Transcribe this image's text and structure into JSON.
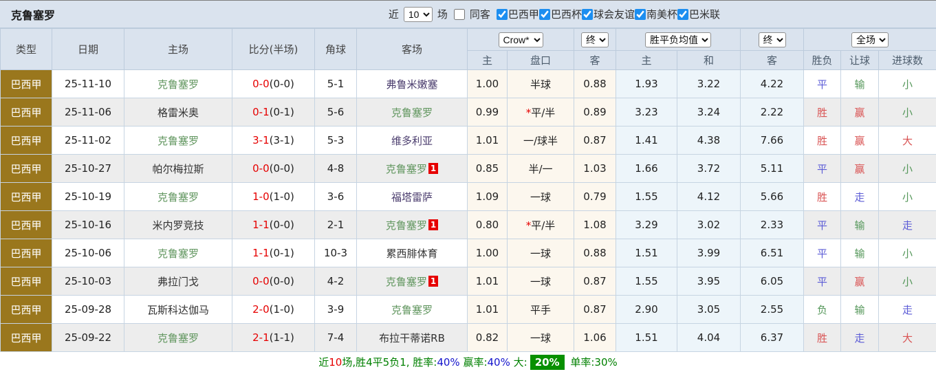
{
  "topbar": {
    "team_title": "克鲁塞罗",
    "recent_label": "近",
    "recent_select": "10",
    "matches_label": "场",
    "same_away": {
      "label": "同客",
      "checked": false
    },
    "competitions": [
      {
        "label": "巴西甲",
        "checked": true
      },
      {
        "label": "巴西杯",
        "checked": true
      },
      {
        "label": "球会友谊",
        "checked": true
      },
      {
        "label": "南美杯",
        "checked": true
      },
      {
        "label": "巴米联",
        "checked": true
      }
    ]
  },
  "table": {
    "headers": {
      "type": "类型",
      "date": "日期",
      "home": "主场",
      "score": "比分(半场)",
      "corners": "角球",
      "away": "客场",
      "asian_select": "Crow*",
      "asian_final_select": "终",
      "europe_select": "胜平负均值",
      "europe_final_select": "终",
      "scope_select": "全场",
      "asian_sub": [
        "主",
        "盘口",
        "客"
      ],
      "europe_sub": [
        "主",
        "和",
        "客"
      ],
      "result_sub": [
        "胜负",
        "让球",
        "进球数"
      ]
    },
    "rows": [
      {
        "league": "巴西甲",
        "date": "25-11-10",
        "home": {
          "name": "克鲁塞罗",
          "style": "self",
          "badge": null
        },
        "score_full": "0-0",
        "score_half": "(0-0)",
        "corners": "5-1",
        "away": {
          "name": "弗鲁米嫩塞",
          "style": "visited",
          "badge": null
        },
        "asian": {
          "home": "1.00",
          "line": "半球",
          "star": false,
          "away": "0.88"
        },
        "europe": {
          "home": "1.93",
          "draw": "3.22",
          "away": "4.22"
        },
        "result": [
          {
            "text": "平",
            "style": "blue"
          },
          {
            "text": "输",
            "style": "green"
          },
          {
            "text": "小",
            "style": "green"
          }
        ]
      },
      {
        "league": "巴西甲",
        "date": "25-11-06",
        "home": {
          "name": "格雷米奥",
          "style": "normal",
          "badge": null
        },
        "score_full": "0-1",
        "score_half": "(0-1)",
        "corners": "5-6",
        "away": {
          "name": "克鲁塞罗",
          "style": "self",
          "badge": null
        },
        "asian": {
          "home": "0.99",
          "line": "平/半",
          "star": true,
          "away": "0.89"
        },
        "europe": {
          "home": "3.23",
          "draw": "3.24",
          "away": "2.22"
        },
        "result": [
          {
            "text": "胜",
            "style": "red"
          },
          {
            "text": "赢",
            "style": "red"
          },
          {
            "text": "小",
            "style": "green"
          }
        ]
      },
      {
        "league": "巴西甲",
        "date": "25-11-02",
        "home": {
          "name": "克鲁塞罗",
          "style": "self",
          "badge": null
        },
        "score_full": "3-1",
        "score_half": "(3-1)",
        "corners": "5-3",
        "away": {
          "name": "维多利亚",
          "style": "visited",
          "badge": null
        },
        "asian": {
          "home": "1.01",
          "line": "一/球半",
          "star": false,
          "away": "0.87"
        },
        "europe": {
          "home": "1.41",
          "draw": "4.38",
          "away": "7.66"
        },
        "result": [
          {
            "text": "胜",
            "style": "red"
          },
          {
            "text": "赢",
            "style": "red"
          },
          {
            "text": "大",
            "style": "red"
          }
        ]
      },
      {
        "league": "巴西甲",
        "date": "25-10-27",
        "home": {
          "name": "帕尔梅拉斯",
          "style": "normal",
          "badge": null
        },
        "score_full": "0-0",
        "score_half": "(0-0)",
        "corners": "4-8",
        "away": {
          "name": "克鲁塞罗",
          "style": "self",
          "badge": "1"
        },
        "asian": {
          "home": "0.85",
          "line": "半/一",
          "star": false,
          "away": "1.03"
        },
        "europe": {
          "home": "1.66",
          "draw": "3.72",
          "away": "5.11"
        },
        "result": [
          {
            "text": "平",
            "style": "blue"
          },
          {
            "text": "赢",
            "style": "red"
          },
          {
            "text": "小",
            "style": "green"
          }
        ]
      },
      {
        "league": "巴西甲",
        "date": "25-10-19",
        "home": {
          "name": "克鲁塞罗",
          "style": "self",
          "badge": null
        },
        "score_full": "1-0",
        "score_half": "(1-0)",
        "corners": "3-6",
        "away": {
          "name": "福塔雷萨",
          "style": "visited",
          "badge": null
        },
        "asian": {
          "home": "1.09",
          "line": "一球",
          "star": false,
          "away": "0.79"
        },
        "europe": {
          "home": "1.55",
          "draw": "4.12",
          "away": "5.66"
        },
        "result": [
          {
            "text": "胜",
            "style": "red"
          },
          {
            "text": "走",
            "style": "blue"
          },
          {
            "text": "小",
            "style": "green"
          }
        ]
      },
      {
        "league": "巴西甲",
        "date": "25-10-16",
        "home": {
          "name": "米内罗竞技",
          "style": "normal",
          "badge": null
        },
        "score_full": "1-1",
        "score_half": "(0-0)",
        "corners": "2-1",
        "away": {
          "name": "克鲁塞罗",
          "style": "self",
          "badge": "1"
        },
        "asian": {
          "home": "0.80",
          "line": "平/半",
          "star": true,
          "away": "1.08"
        },
        "europe": {
          "home": "3.29",
          "draw": "3.02",
          "away": "2.33"
        },
        "result": [
          {
            "text": "平",
            "style": "blue"
          },
          {
            "text": "输",
            "style": "green"
          },
          {
            "text": "走",
            "style": "blue"
          }
        ]
      },
      {
        "league": "巴西甲",
        "date": "25-10-06",
        "home": {
          "name": "克鲁塞罗",
          "style": "self",
          "badge": null
        },
        "score_full": "1-1",
        "score_half": "(0-1)",
        "corners": "10-3",
        "away": {
          "name": "累西腓体育",
          "style": "normal",
          "badge": null
        },
        "asian": {
          "home": "1.00",
          "line": "一球",
          "star": false,
          "away": "0.88"
        },
        "europe": {
          "home": "1.51",
          "draw": "3.99",
          "away": "6.51"
        },
        "result": [
          {
            "text": "平",
            "style": "blue"
          },
          {
            "text": "输",
            "style": "green"
          },
          {
            "text": "小",
            "style": "green"
          }
        ]
      },
      {
        "league": "巴西甲",
        "date": "25-10-03",
        "home": {
          "name": "弗拉门戈",
          "style": "normal",
          "badge": null
        },
        "score_full": "0-0",
        "score_half": "(0-0)",
        "corners": "4-2",
        "away": {
          "name": "克鲁塞罗",
          "style": "self",
          "badge": "1"
        },
        "asian": {
          "home": "1.01",
          "line": "一球",
          "star": false,
          "away": "0.87"
        },
        "europe": {
          "home": "1.55",
          "draw": "3.95",
          "away": "6.05"
        },
        "result": [
          {
            "text": "平",
            "style": "blue"
          },
          {
            "text": "赢",
            "style": "red"
          },
          {
            "text": "小",
            "style": "green"
          }
        ]
      },
      {
        "league": "巴西甲",
        "date": "25-09-28",
        "home": {
          "name": "瓦斯科达伽马",
          "style": "normal",
          "badge": null
        },
        "score_full": "2-0",
        "score_half": "(1-0)",
        "corners": "3-9",
        "away": {
          "name": "克鲁塞罗",
          "style": "self",
          "badge": null
        },
        "asian": {
          "home": "1.01",
          "line": "平手",
          "star": false,
          "away": "0.87"
        },
        "europe": {
          "home": "2.90",
          "draw": "3.05",
          "away": "2.55"
        },
        "result": [
          {
            "text": "负",
            "style": "green"
          },
          {
            "text": "输",
            "style": "green"
          },
          {
            "text": "走",
            "style": "blue"
          }
        ]
      },
      {
        "league": "巴西甲",
        "date": "25-09-22",
        "home": {
          "name": "克鲁塞罗",
          "style": "self",
          "badge": null
        },
        "score_full": "2-1",
        "score_half": "(1-1)",
        "corners": "7-4",
        "away": {
          "name": "布拉干蒂诺RB",
          "style": "normal",
          "badge": null
        },
        "asian": {
          "home": "0.82",
          "line": "一球",
          "star": false,
          "away": "1.06"
        },
        "europe": {
          "home": "1.51",
          "draw": "4.04",
          "away": "6.37"
        },
        "result": [
          {
            "text": "胜",
            "style": "red"
          },
          {
            "text": "走",
            "style": "blue"
          },
          {
            "text": "大",
            "style": "red"
          }
        ]
      }
    ]
  },
  "footer": {
    "segments": [
      {
        "text": "近",
        "style": "green"
      },
      {
        "text": "10",
        "style": "red"
      },
      {
        "text": "场,胜4平5负1, ",
        "style": "green"
      },
      {
        "text": "胜率:",
        "style": "green"
      },
      {
        "text": "40%",
        "style": "blue"
      },
      {
        "text": " 赢率:",
        "style": "green"
      },
      {
        "text": "40%",
        "style": "blue"
      },
      {
        "text": " 大:",
        "style": "green"
      },
      {
        "text": "20%",
        "style": "badge-green"
      },
      {
        "text": " 单率:",
        "style": "green"
      },
      {
        "text": "30%",
        "style": "green"
      }
    ]
  },
  "colors": {
    "header_bg": "#dae3ee",
    "league_cell_bg": "#9a771d",
    "score_red": "#e60000",
    "result_red": "#d95454",
    "result_blue": "#5b5bd6",
    "result_green": "#55975a",
    "team_self_green": "#61965f",
    "asian_cols_bg": "#fcf7ee",
    "europe_cols_bg": "#edf5fa",
    "footer_badge_bg": "#089000",
    "checkbox_blue": "#1c8ef0"
  }
}
